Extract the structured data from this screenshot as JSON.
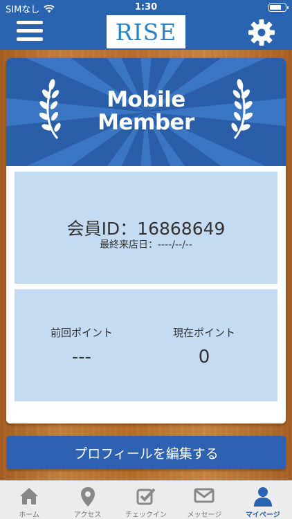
{
  "status_bar": {
    "carrier": "SIMなし",
    "time": "1:30"
  },
  "header": {
    "logo_text": "RISE"
  },
  "banner": {
    "title_line1": "Mobile",
    "title_line2": "Member"
  },
  "member": {
    "id_text": "会員ID：16868649",
    "last_visit_text": "最終来店日：----/--/--"
  },
  "points": {
    "previous_label": "前回ポイント",
    "previous_value": "---",
    "current_label": "現在ポイント",
    "current_value": "0"
  },
  "edit_profile_label": "プロフィールを編集する",
  "tabs": [
    {
      "label": "ホーム",
      "icon": "home-icon",
      "active": false
    },
    {
      "label": "アクセス",
      "icon": "map-pin-icon",
      "active": false
    },
    {
      "label": "チェックイン",
      "icon": "checkin-icon",
      "active": false
    },
    {
      "label": "メッセージ",
      "icon": "mail-icon",
      "active": false
    },
    {
      "label": "マイページ",
      "icon": "user-icon",
      "active": true
    }
  ],
  "colors": {
    "primary": "#2a64b1",
    "panel": "#c5dbf2",
    "logo_text": "#2a83c9"
  }
}
